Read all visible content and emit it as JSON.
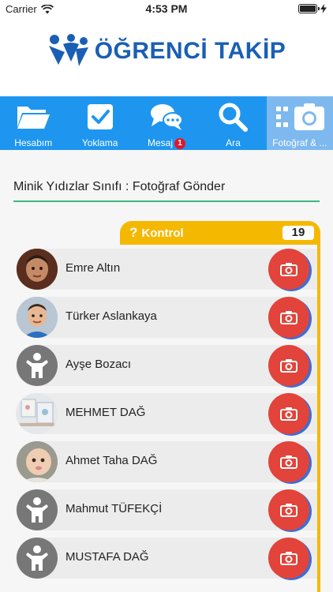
{
  "status_bar": {
    "carrier": "Carrier",
    "time": "4:53 PM"
  },
  "header": {
    "logo_text": "ÖĞRENCİ TAKİP"
  },
  "tabs": [
    {
      "label": "Hesabım",
      "icon": "folder-icon"
    },
    {
      "label": "Yoklama",
      "icon": "checkbox-icon"
    },
    {
      "label": "Mesaj",
      "icon": "chat-bubbles-icon",
      "badge": "1"
    },
    {
      "label": "Ara",
      "icon": "search-icon"
    },
    {
      "label": "Fotoğraf & ...",
      "icon": "camera-icon",
      "active": true
    }
  ],
  "page": {
    "title": "Minik Yıdızlar Sınıfı : Fotoğraf Gönder",
    "kontrol_label": "Kontrol",
    "kontrol_icon": "question-icon",
    "kontrol_count": "19"
  },
  "students": [
    {
      "name": "Emre Altın",
      "avatar": "photo"
    },
    {
      "name": "Türker Aslankaya",
      "avatar": "photo"
    },
    {
      "name": "Ayşe Bozacı",
      "avatar": "person-placeholder-icon"
    },
    {
      "name": "MEHMET DAĞ",
      "avatar": "photo"
    },
    {
      "name": "Ahmet Taha DAĞ",
      "avatar": "photo"
    },
    {
      "name": "Mahmut TÜFEKÇİ",
      "avatar": "person-placeholder-icon"
    },
    {
      "name": "MUSTAFA DAĞ",
      "avatar": "person-placeholder-icon"
    }
  ],
  "colors": {
    "tabbar": "#1e96f0",
    "tab_active": "#7db9ee",
    "kontrol": "#f5b800",
    "camera_button": "#e2433a",
    "title_underline": "#3cb878",
    "logo": "#1a5fb4"
  }
}
